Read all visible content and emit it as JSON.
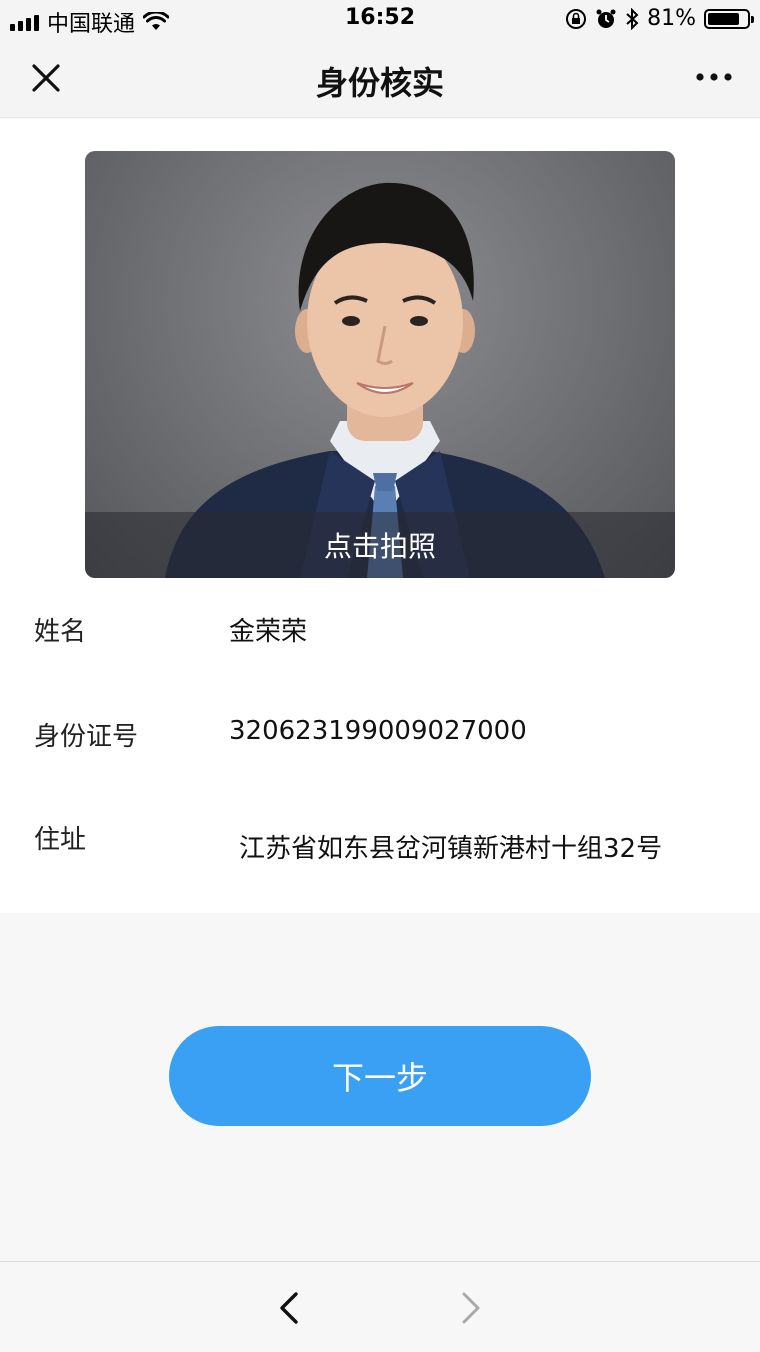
{
  "status_bar": {
    "carrier": "中国联通",
    "time": "16:52",
    "battery": "81%",
    "battery_level": 0.81,
    "icons": [
      "signal-icon",
      "wifi-icon",
      "orientation-lock-icon",
      "alarm-icon",
      "bluetooth-icon",
      "battery-icon"
    ]
  },
  "nav": {
    "title": "身份核实",
    "close_icon": "close-icon",
    "more_icon": "more-icon"
  },
  "photo": {
    "overlay_label": "点击拍照"
  },
  "info": {
    "name_label": "姓名",
    "name_value": "金荣荣",
    "id_label": "身份证号",
    "id_value": "320623199009027000",
    "address_label": "住址",
    "address_value": "江苏省如东县岔河镇新港村十组32号"
  },
  "actions": {
    "next_label": "下一步"
  },
  "bottom_bar": {
    "back_icon": "chevron-left-icon",
    "forward_icon": "chevron-right-icon"
  },
  "colors": {
    "accent": "#3aa0f4",
    "background": "#f7f7f7",
    "card": "#ffffff"
  }
}
